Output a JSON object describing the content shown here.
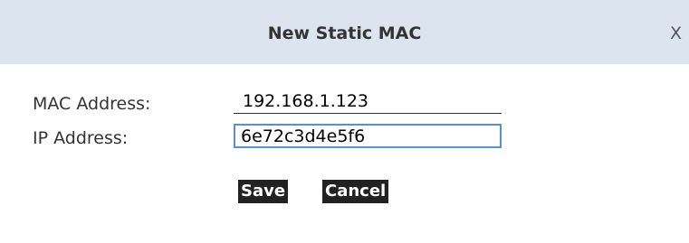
{
  "dialog": {
    "title": "New Static MAC",
    "close_label": "X"
  },
  "form": {
    "mac_label": "MAC Address:",
    "mac_value": "192.168.1.123",
    "ip_label": "IP Address:",
    "ip_value": "6e72c3d4e5f6"
  },
  "buttons": {
    "save_label": "Save",
    "cancel_label": "Cancel"
  },
  "colors": {
    "titlebar_bg": "#dce5ef",
    "button_bg": "#222222",
    "focus_border": "#5a8fd6"
  }
}
